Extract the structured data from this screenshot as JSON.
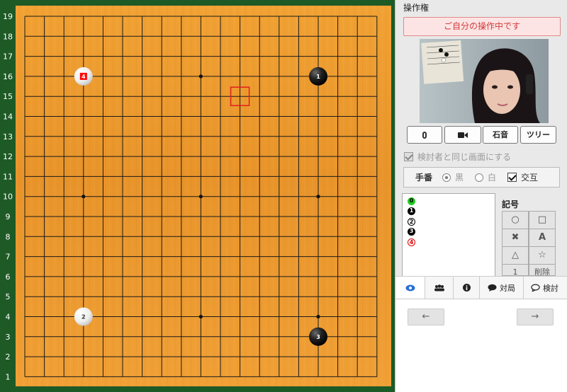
{
  "board": {
    "size": 19,
    "row_labels": [
      "19",
      "18",
      "17",
      "16",
      "15",
      "14",
      "13",
      "12",
      "11",
      "10",
      "9",
      "8",
      "7",
      "6",
      "5",
      "4",
      "3",
      "2",
      "1"
    ],
    "stones": [
      {
        "col": 16,
        "row": 16,
        "color": "black",
        "number": "1"
      },
      {
        "col": 4,
        "row": 4,
        "color": "white",
        "number": "2"
      },
      {
        "col": 16,
        "row": 3,
        "color": "black",
        "number": "3"
      },
      {
        "col": 4,
        "row": 16,
        "color": "white",
        "number": "4",
        "last_move": true
      }
    ],
    "star_points": [
      [
        4,
        4
      ],
      [
        10,
        4
      ],
      [
        16,
        4
      ],
      [
        4,
        10
      ],
      [
        10,
        10
      ],
      [
        16,
        10
      ],
      [
        4,
        16
      ],
      [
        10,
        16
      ],
      [
        16,
        16
      ]
    ],
    "cursor": {
      "col": 12,
      "row": 15
    },
    "colors": {
      "frame": "#1e5a26",
      "line": "#1a1a1a",
      "cursor": "#e02020",
      "last_move_marker": "#ff0000"
    }
  },
  "panel": {
    "control_title": "操作権",
    "control_banner": "ご自分の操作中です",
    "media_buttons": {
      "mic_icon": "microphone-icon",
      "camera_icon": "video-camera-icon",
      "stone_sound": "石音",
      "tree": "ツリー"
    },
    "same_screen_label": "検討者と同じ画面にする",
    "turn": {
      "label": "手番",
      "black": "黒",
      "white": "白",
      "alternate": "交互"
    },
    "move_list": [
      {
        "label": "0",
        "style": "green"
      },
      {
        "label": "1",
        "style": "black"
      },
      {
        "label": "2",
        "style": "white"
      },
      {
        "label": "3",
        "style": "black"
      },
      {
        "label": "4",
        "style": "red"
      }
    ],
    "symbols": {
      "title": "記号",
      "circle": "○",
      "square": "□",
      "cross": "✖",
      "letter": "A",
      "triangle": "△",
      "star": "☆",
      "number": "1",
      "delete": "削除"
    }
  },
  "tabs": {
    "view_icon": "eye-icon",
    "users_icon": "users-icon",
    "info_icon": "info-icon",
    "game_label": "対局",
    "review_label": "検討"
  },
  "nav": {
    "back_icon": "arrow-left-icon",
    "forward_icon": "arrow-right-icon",
    "back": "←",
    "forward": "→"
  }
}
